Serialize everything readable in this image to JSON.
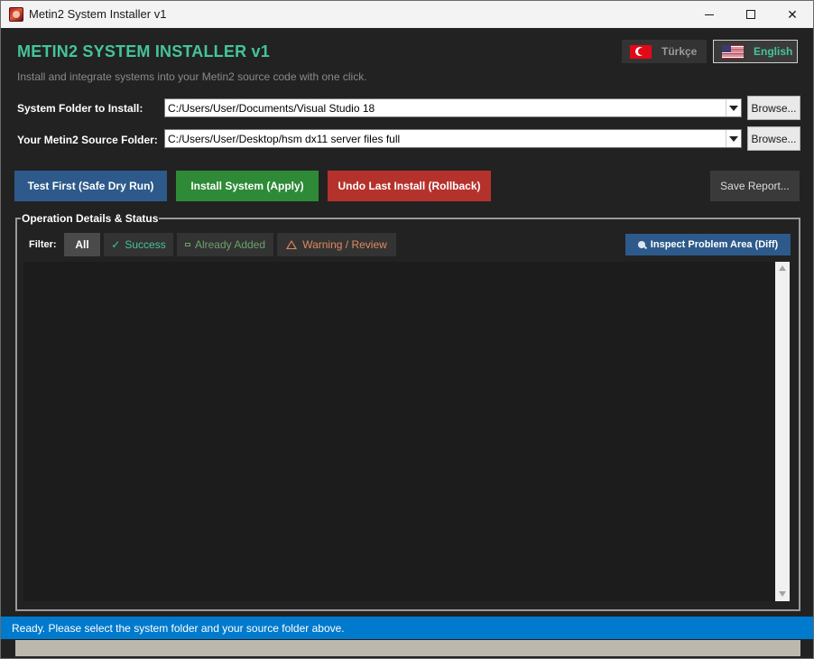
{
  "window": {
    "title": "Metin2 System Installer v1",
    "icon": "app-icon"
  },
  "header": {
    "title": "METIN2 SYSTEM INSTALLER v1",
    "subtitle": "Install and integrate systems into your Metin2 source code with one click.",
    "accent_color": "#45c49a"
  },
  "language": {
    "turkish_label": "Türkçe",
    "english_label": "English",
    "selected": "English"
  },
  "folders": {
    "system_label": "System Folder to Install:",
    "system_value": "C:/Users/User/Documents/Visual Studio 18",
    "source_label": "Your Metin2 Source Folder:",
    "source_value": "C:/Users/User/Desktop/hsm dx11 server files full",
    "browse_label": "Browse..."
  },
  "actions": {
    "test_label": "Test First (Safe Dry Run)",
    "install_label": "Install System (Apply)",
    "undo_label": "Undo Last Install (Rollback)",
    "report_label": "Save Report...",
    "colors": {
      "test": "#2d5a8a",
      "install": "#2e8a37",
      "undo": "#b5322c"
    }
  },
  "details": {
    "group_title": "Operation Details & Status",
    "filter_label": "Filter:",
    "filters": {
      "all": "All",
      "success": "Success",
      "already_added": "Already Added",
      "warning": "Warning / Review"
    },
    "active_filter": "All",
    "inspect_label": "Inspect Problem Area (Diff)"
  },
  "status": {
    "text": "Ready. Please select the system folder and your source folder above.",
    "color": "#007acc"
  },
  "progress": {
    "value": 0
  }
}
